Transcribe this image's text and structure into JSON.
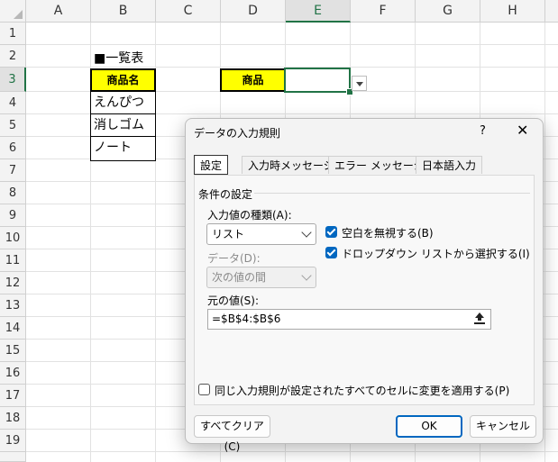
{
  "sheet": {
    "columns": [
      "A",
      "B",
      "C",
      "D",
      "E",
      "F",
      "G",
      "H"
    ],
    "rows": [
      "1",
      "2",
      "3",
      "4",
      "5",
      "6",
      "7",
      "8",
      "9",
      "10",
      "11",
      "12",
      "13",
      "14",
      "15",
      "16",
      "17",
      "18",
      "19"
    ],
    "selected_column": "E",
    "selected_row": "3",
    "b2_text": "■一覧表",
    "b3_header": "商品名",
    "list_items": [
      "えんぴつ",
      "消しゴム",
      "ノート"
    ],
    "d3_label": "商品",
    "e3_value": ""
  },
  "dialog": {
    "title": "データの入力規則",
    "help_label": "?",
    "close_label": "✕",
    "tabs": [
      {
        "label": "設定",
        "active": true
      },
      {
        "label": "入力時メッセージ",
        "active": false
      },
      {
        "label": "エラー メッセージ",
        "active": false
      },
      {
        "label": "日本語入力",
        "active": false
      }
    ],
    "group_title": "条件の設定",
    "allow_label": "入力値の種類(A):",
    "allow_value": "リスト",
    "data_label": "データ(D):",
    "data_value": "次の値の間",
    "ignore_blank_label": "空白を無視する(B)",
    "ignore_blank_checked": true,
    "in_cell_dropdown_label": "ドロップダウン リストから選択する(I)",
    "in_cell_dropdown_checked": true,
    "source_label": "元の値(S):",
    "source_value": "=$B$4:$B$6",
    "apply_all_label": "同じ入力規則が設定されたすべてのセルに変更を適用する(P)",
    "apply_all_checked": false,
    "clear_all_label": "すべてクリア(C)",
    "ok_label": "OK",
    "cancel_label": "キャンセル",
    "accent_color": "#0067c0"
  }
}
